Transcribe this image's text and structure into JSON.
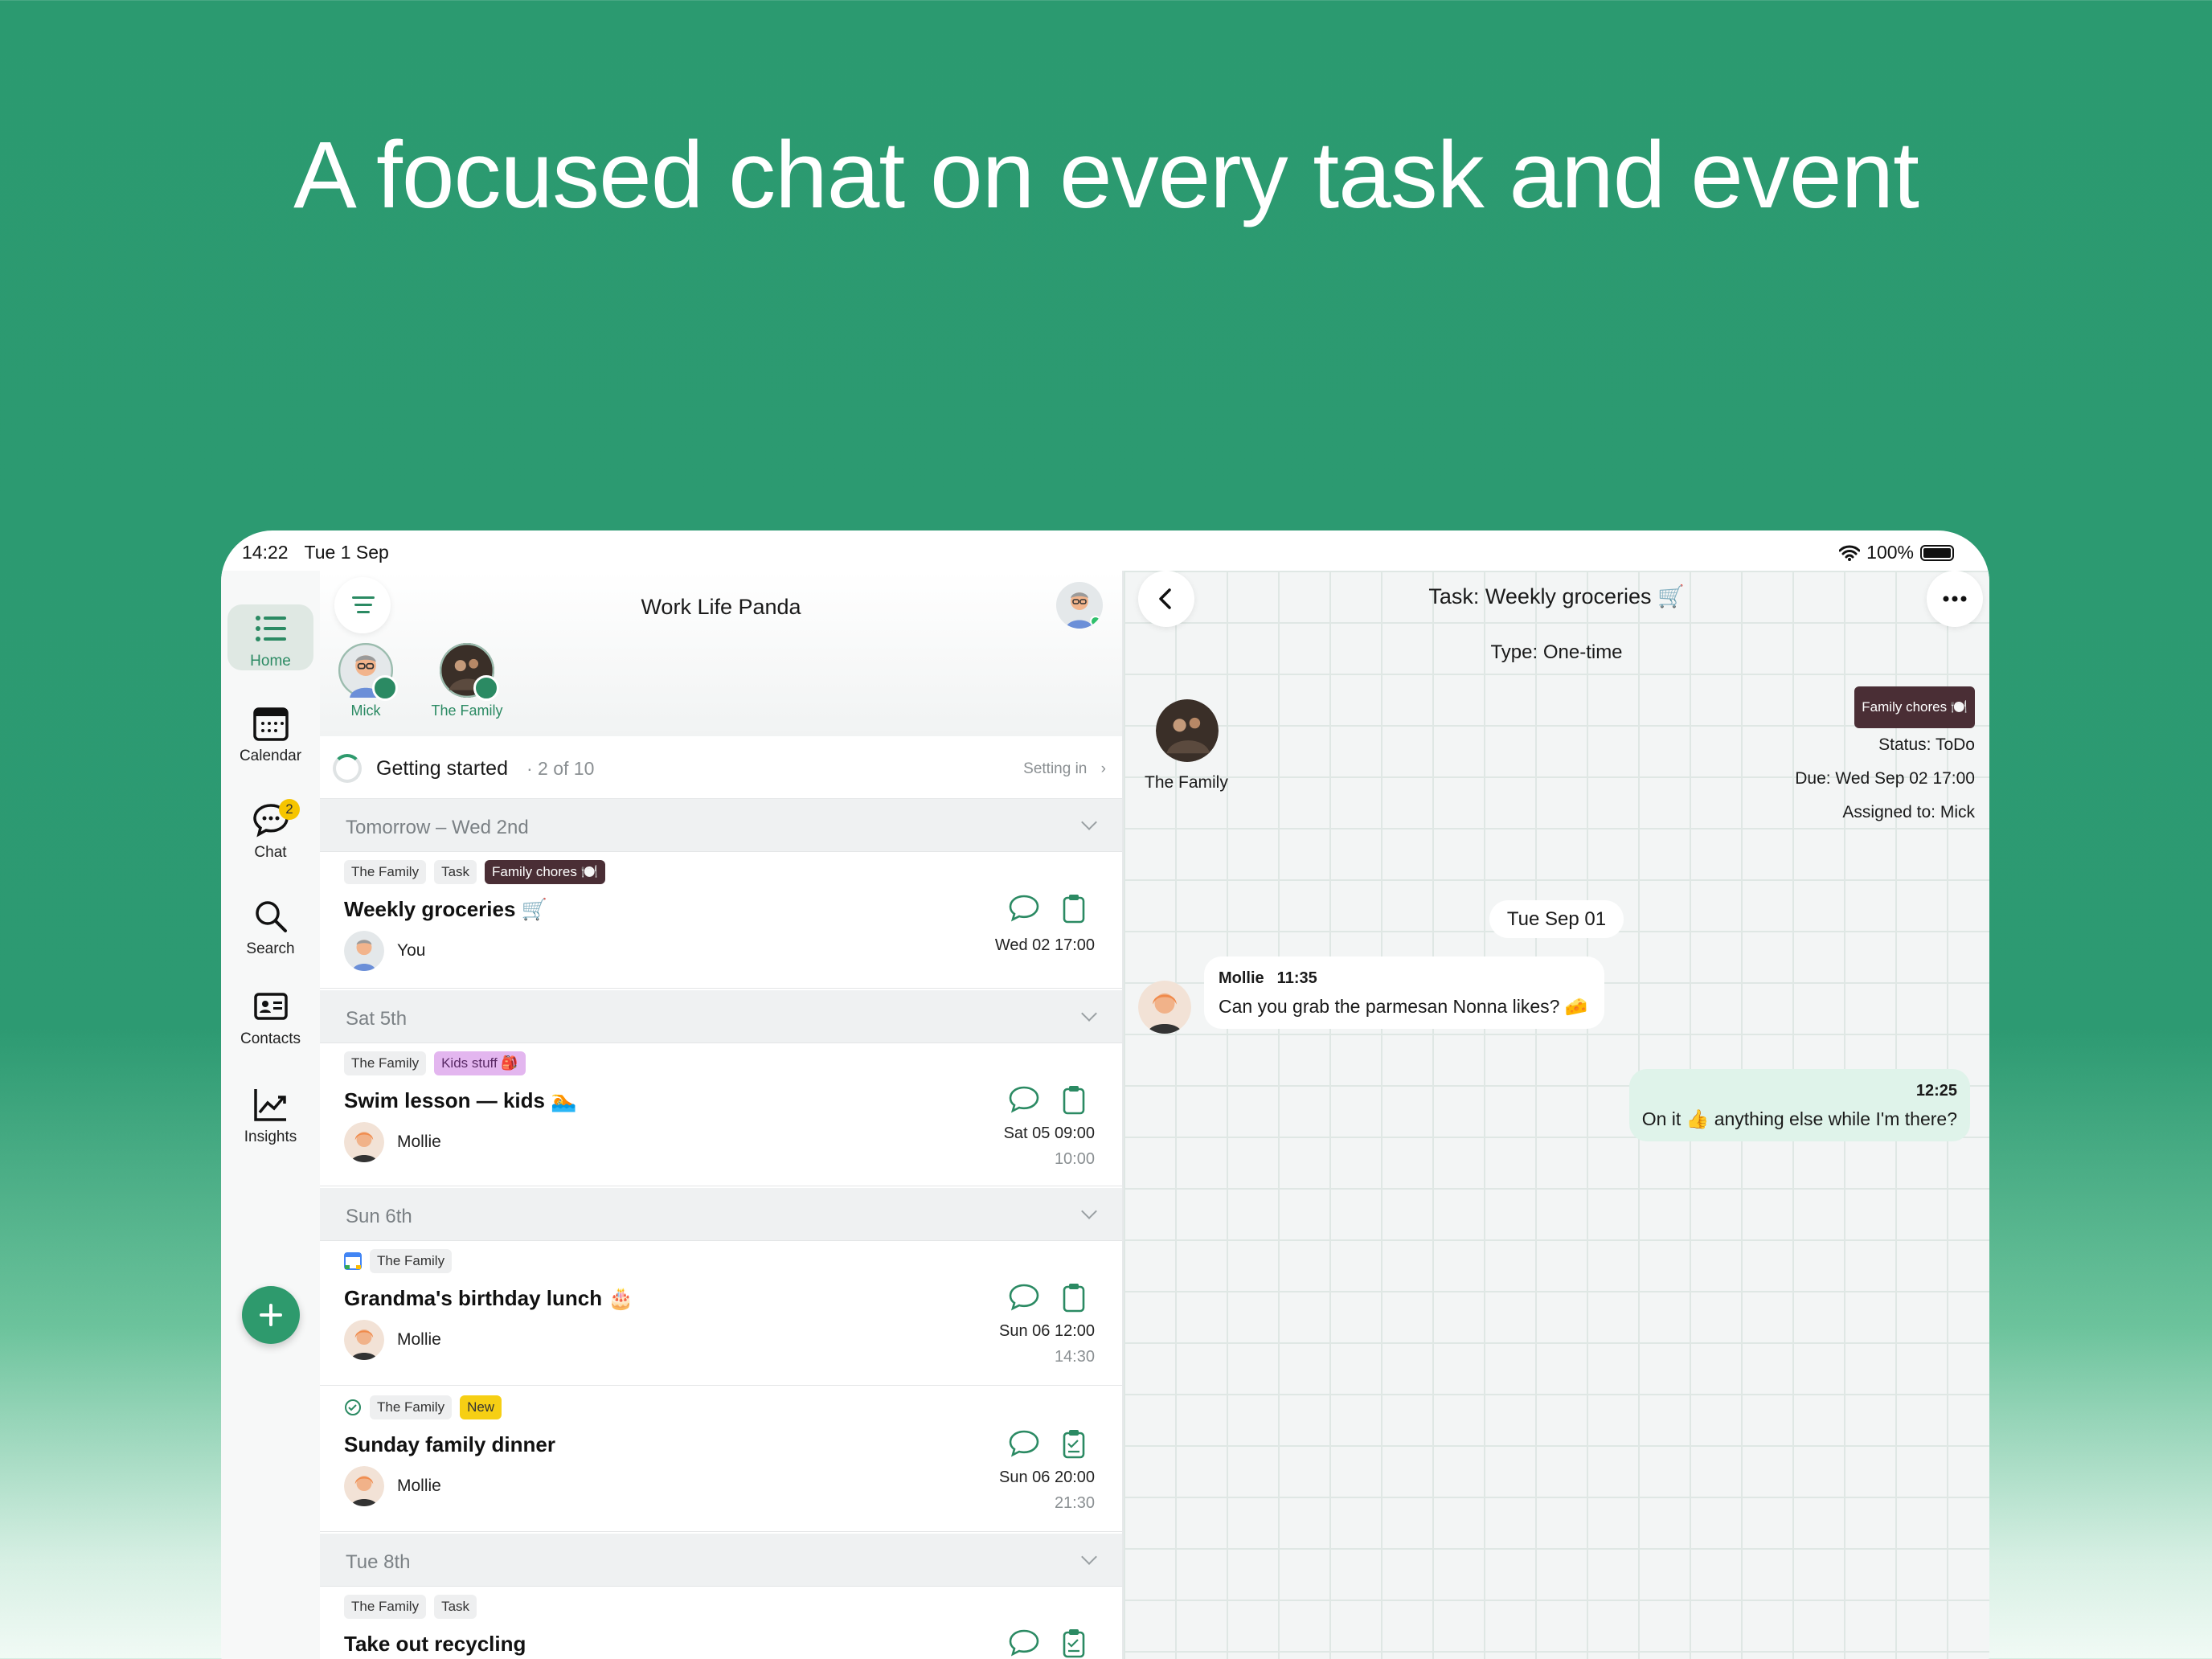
{
  "headline": "A focused chat on every task and event",
  "status": {
    "time": "14:22",
    "date": "Tue 1 Sep",
    "battery": "100%"
  },
  "nav": {
    "home": "Home",
    "calendar": "Calendar",
    "chat": "Chat",
    "chat_badge": "2",
    "search": "Search",
    "contacts": "Contacts",
    "insights": "Insights"
  },
  "list": {
    "title": "Work Life Panda",
    "people": [
      {
        "name": "Mick"
      },
      {
        "name": "The Family"
      }
    ],
    "getting_started": {
      "title": "Getting started",
      "count": "· 2 of 10",
      "status": "Setting in"
    },
    "days": [
      "Tomorrow – Wed 2nd",
      "Sat 5th",
      "Sun 6th",
      "Tue 8th"
    ],
    "items": [
      {
        "tags": [
          "The Family",
          "Task",
          "Family chores 🍽️"
        ],
        "title": "Weekly groceries 🛒",
        "assignee": "You",
        "when": "Wed 02 17:00",
        "end": ""
      },
      {
        "tags": [
          "The Family",
          "Kids stuff 🎒"
        ],
        "title": "Swim lesson — kids 🏊",
        "assignee": "Mollie",
        "when": "Sat 05 09:00",
        "end": "10:00"
      },
      {
        "tags": [
          "The Family"
        ],
        "title": "Grandma's birthday lunch 🎂",
        "assignee": "Mollie",
        "when": "Sun 06 12:00",
        "end": "14:30"
      },
      {
        "tags": [
          "The Family",
          "New"
        ],
        "title": "Sunday family dinner",
        "assignee": "Mollie",
        "when": "Sun 06 20:00",
        "end": "21:30"
      },
      {
        "tags": [
          "The Family",
          "Task"
        ],
        "title": "Take out recycling",
        "assignee": "",
        "when": "",
        "end": ""
      }
    ]
  },
  "chat": {
    "title": "Task: Weekly groceries 🛒",
    "type": "Type: One-time",
    "group": "The Family",
    "tag": "Family chores 🍽️",
    "status": "Status: ToDo",
    "due": "Due: Wed Sep 02 17:00",
    "assigned": "Assigned to: Mick",
    "date": "Tue Sep 01",
    "incoming": {
      "sender": "Mollie",
      "time": "11:35",
      "text": "Can you grab the parmesan Nonna likes? 🧀"
    },
    "outgoing": {
      "time": "12:25",
      "text": "On it 👍 anything else while I'm there?"
    }
  },
  "colors": {
    "brand": "#2b9a70",
    "accent": "#2e9a6d",
    "chores_tag": "#4a2e35",
    "kids_tag": "#e3b6ef",
    "new_tag": "#f6cf14"
  }
}
